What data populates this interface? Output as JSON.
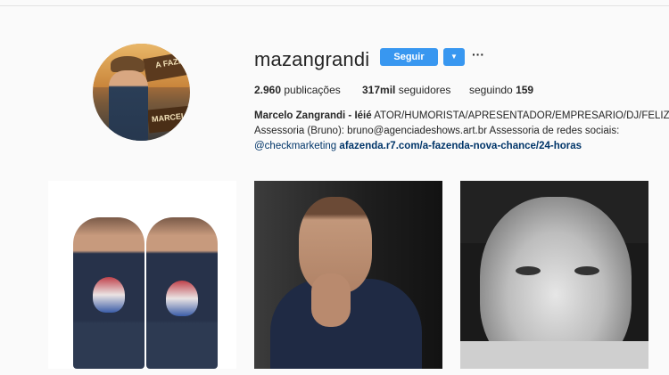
{
  "profile": {
    "username": "mazangrandi",
    "follow_label": "Seguir",
    "dropdown_icon": "chevron-down-icon",
    "more_label": "···",
    "avatar_sign_text": "A FAZEN",
    "avatar_sign_text2": "MARCEL"
  },
  "stats": {
    "posts_value": "2.960",
    "posts_label": "publicações",
    "followers_value": "317mil",
    "followers_label": "seguidores",
    "following_label": "seguindo",
    "following_value": "159"
  },
  "bio": {
    "name": "Marcelo Zangrandi - Iéié",
    "line1_rest": "ATOR/HUMORISTA/APRESENTADOR/EMPRESARIO/DJ/FELIZ",
    "line2": "Assessoria (Bruno): bruno@agenciadeshows.art.br Assessoria de redes sociais:",
    "mention": "@checkmarketing",
    "link": "afazenda.r7.com/a-fazenda-nova-chance/24-horas"
  },
  "colors": {
    "accent": "#3897f0",
    "background": "#fafafa",
    "text": "#262626",
    "link": "#003569"
  }
}
